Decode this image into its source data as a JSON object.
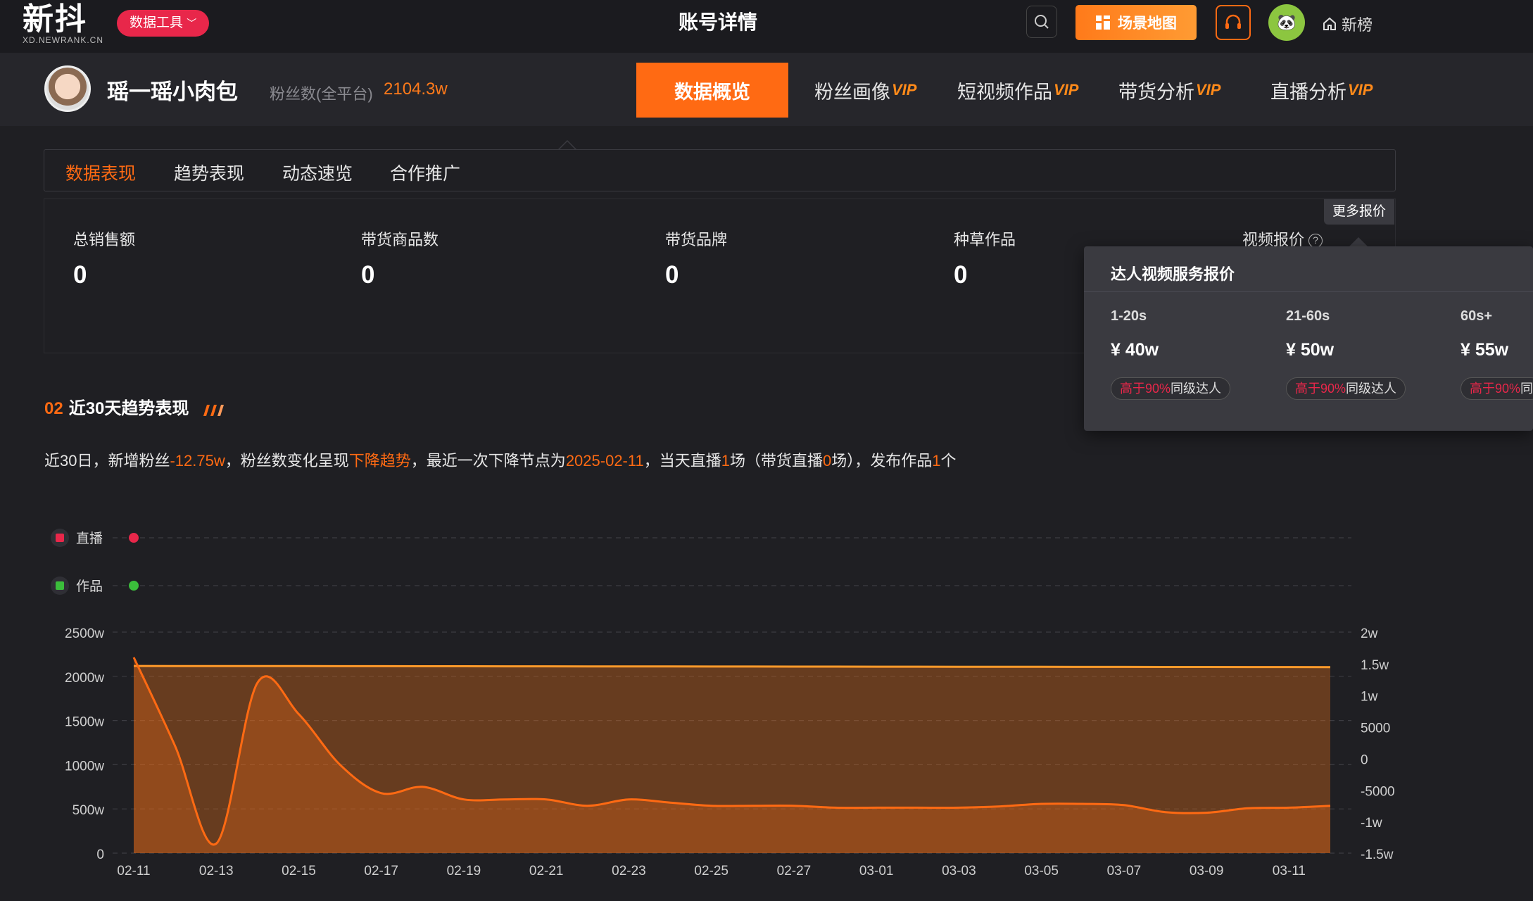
{
  "header": {
    "logo_main": "新抖",
    "logo_sub": "XD.NEWRANK.CN",
    "tool_button": "数据工具",
    "page_title": "账号详情",
    "scene_button": "场景地图",
    "home_link": "新榜"
  },
  "account": {
    "name": "瑶一瑶小肉包",
    "fans_label": "粉丝数(全平台)",
    "fans_value": "2104.3w",
    "tabs": [
      {
        "label": "数据概览",
        "vip": ""
      },
      {
        "label": "粉丝画像",
        "vip": "VIP"
      },
      {
        "label": "短视频作品",
        "vip": "VIP"
      },
      {
        "label": "带货分析",
        "vip": "VIP"
      },
      {
        "label": "直播分析",
        "vip": "VIP"
      }
    ]
  },
  "subtabs": [
    "数据表现",
    "趋势表现",
    "动态速览",
    "合作推广"
  ],
  "stats": {
    "items": [
      {
        "label": "总销售额",
        "value": "0"
      },
      {
        "label": "带货商品数",
        "value": "0"
      },
      {
        "label": "带货品牌",
        "value": "0"
      },
      {
        "label": "种草作品",
        "value": "0"
      }
    ],
    "video_price_label": "视频报价",
    "more_price": "更多报价"
  },
  "popup": {
    "title": "达人视频服务报价",
    "tiers": [
      {
        "range": "1-20s",
        "price": "¥ 40w",
        "badge_hl": "高于90%",
        "badge_rest": "同级达人"
      },
      {
        "range": "21-60s",
        "price": "¥ 50w",
        "badge_hl": "高于90%",
        "badge_rest": "同级达人"
      },
      {
        "range": "60s+",
        "price": "¥ 55w",
        "badge_hl": "高于90%",
        "badge_rest": "同"
      }
    ]
  },
  "section": {
    "num": "02",
    "title": "近30天趋势表现",
    "summary": {
      "p1": "近30日，新增粉丝",
      "fans_change": "-12.75w",
      "p2": "，粉丝数变化呈现",
      "trend": "下降趋势",
      "p3": "，最近一次下降节点为",
      "date": "2025-02-11",
      "p4": "，当天直播",
      "live": "1",
      "p5": "场（带货直播",
      "sales_live": "0",
      "p6": "场），发布作品",
      "works": "1",
      "p7": "个"
    }
  },
  "chart_data": {
    "type": "line",
    "legend_rows": [
      {
        "name": "直播",
        "color": "#e8274a",
        "dates": [
          "02-11"
        ]
      },
      {
        "name": "作品",
        "color": "#3bbd3b",
        "dates": [
          "02-11"
        ]
      }
    ],
    "categories": [
      "02-11",
      "02-12",
      "02-13",
      "02-14",
      "02-15",
      "02-16",
      "02-17",
      "02-18",
      "02-19",
      "02-20",
      "02-21",
      "02-22",
      "02-23",
      "02-24",
      "02-25",
      "02-26",
      "02-27",
      "02-28",
      "03-01",
      "03-02",
      "03-03",
      "03-04",
      "03-05",
      "03-06",
      "03-07",
      "03-08",
      "03-09",
      "03-10",
      "03-11",
      "03-12"
    ],
    "x_tick_labels": [
      "02-11",
      "02-13",
      "02-15",
      "02-17",
      "02-19",
      "02-21",
      "02-23",
      "02-25",
      "02-27",
      "03-01",
      "03-03",
      "03-05",
      "03-07",
      "03-09",
      "03-11"
    ],
    "y_left_ticks": [
      "0",
      "500w",
      "1000w",
      "1500w",
      "2000w",
      "2500w"
    ],
    "y_left_lim": [
      0,
      2500
    ],
    "y_right_ticks": [
      "-1.5w",
      "-1w",
      "-5000",
      "0",
      "5000",
      "1w",
      "1.5w",
      "2w"
    ],
    "y_right_lim": [
      -15000,
      20000
    ],
    "series": [
      {
        "axis": "left",
        "unit": "w",
        "values": [
          2117.1,
          2116.6,
          2116.2,
          2115.8,
          2115.3,
          2114.9,
          2114.5,
          2114.0,
          2113.6,
          2113.1,
          2112.7,
          2112.3,
          2111.8,
          2111.4,
          2110.9,
          2110.5,
          2110.0,
          2109.6,
          2109.1,
          2108.7,
          2108.2,
          2107.8,
          2107.3,
          2106.9,
          2106.5,
          2106.1,
          2105.6,
          2105.2,
          2104.8,
          2104.3
        ]
      },
      {
        "axis": "right",
        "unit": "",
        "values": [
          16000,
          2000,
          -13500,
          12000,
          7000,
          -1000,
          -5500,
          -4500,
          -6500,
          -6500,
          -6500,
          -7500,
          -6500,
          -7000,
          -7500,
          -7500,
          -7500,
          -7800,
          -7800,
          -7800,
          -7800,
          -7600,
          -7200,
          -7200,
          -7400,
          -8500,
          -8600,
          -7900,
          -7800,
          -7500
        ]
      }
    ]
  }
}
